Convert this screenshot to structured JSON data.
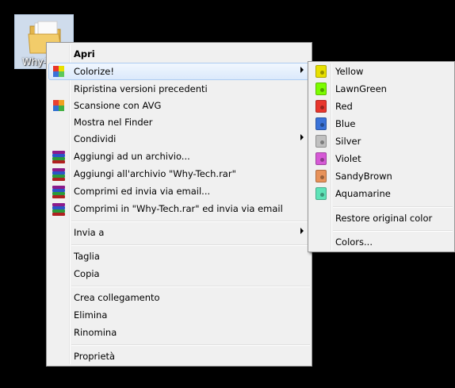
{
  "desktop": {
    "icon_label": "Why-T"
  },
  "context_menu": {
    "items": [
      {
        "label": "Apri"
      },
      {
        "label": "Colorize!"
      },
      {
        "label": "Ripristina versioni precedenti"
      },
      {
        "label": "Scansione con AVG"
      },
      {
        "label": "Mostra nel Finder"
      },
      {
        "label": "Condividi"
      },
      {
        "label": "Aggiungi ad un archivio..."
      },
      {
        "label": "Aggiungi all'archivio \"Why-Tech.rar\""
      },
      {
        "label": "Comprimi ed invia via email..."
      },
      {
        "label": "Comprimi in \"Why-Tech.rar\" ed invia via email"
      },
      {
        "label": "Invia a"
      },
      {
        "label": "Taglia"
      },
      {
        "label": "Copia"
      },
      {
        "label": "Crea collegamento"
      },
      {
        "label": "Elimina"
      },
      {
        "label": "Rinomina"
      },
      {
        "label": "Proprietà"
      }
    ]
  },
  "colorize_submenu": {
    "colors": [
      {
        "label": "Yellow",
        "hex": "#e8e000"
      },
      {
        "label": "LawnGreen",
        "hex": "#7cfc00"
      },
      {
        "label": "Red",
        "hex": "#e8362c"
      },
      {
        "label": "Blue",
        "hex": "#3a72d8"
      },
      {
        "label": "Silver",
        "hex": "#c0c0c0"
      },
      {
        "label": "Violet",
        "hex": "#d65ad6"
      },
      {
        "label": "SandyBrown",
        "hex": "#e8925a"
      },
      {
        "label": "Aquamarine",
        "hex": "#5fe3b8"
      }
    ],
    "restore_label": "Restore original color",
    "colors_label": "Colors..."
  }
}
